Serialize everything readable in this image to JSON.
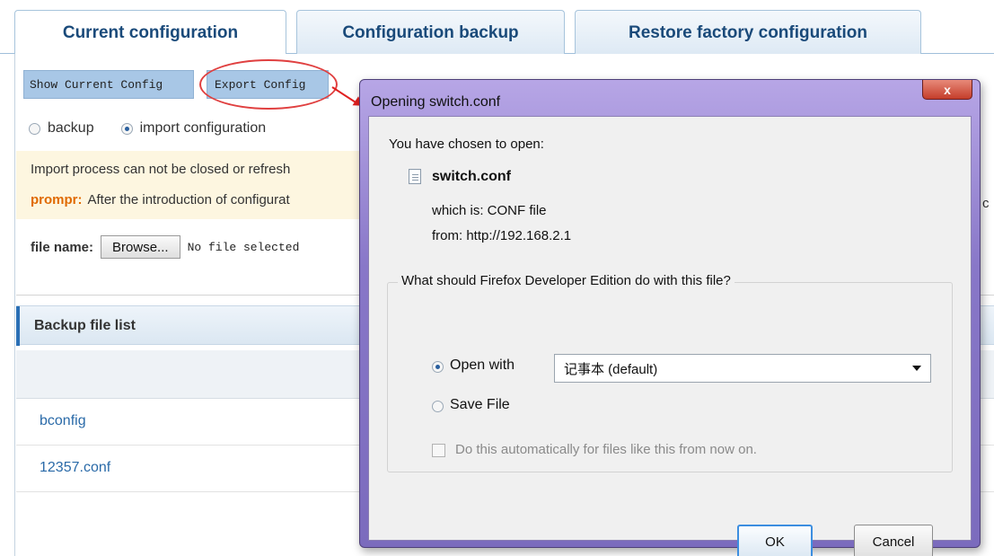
{
  "tabs": {
    "current": "Current configuration",
    "backup": "Configuration backup",
    "restore": "Restore factory configuration"
  },
  "toolbar": {
    "show": "Show Current Config",
    "export": "Export Config"
  },
  "options": {
    "backup": "backup",
    "import": "import configuration"
  },
  "notice": {
    "line1": "Import process can not be closed or refresh",
    "prompt_label": "prompr:",
    "line2": "After the introduction of configurat",
    "trailing_char": "c"
  },
  "file": {
    "label": "file name:",
    "browse": "Browse...",
    "status": "No file selected"
  },
  "backup_list": {
    "title": "Backup file list",
    "rows": [
      "bconfig",
      "12357.conf"
    ]
  },
  "dialog": {
    "title": "Opening switch.conf",
    "close": "x",
    "chosen": "You have chosen to open:",
    "filename": "switch.conf",
    "which_is": "which is: CONF file",
    "from": "from: http://192.168.2.1",
    "question": "What should Firefox Developer Edition do with this file?",
    "open_with": "Open with",
    "app": "记事本 (default)",
    "save_file": "Save File",
    "auto": "Do this automatically for files like this from now on.",
    "ok": "OK",
    "cancel": "Cancel"
  },
  "colors": {
    "accent": "#2a6fb5",
    "highlight_ring": "#e04040"
  }
}
